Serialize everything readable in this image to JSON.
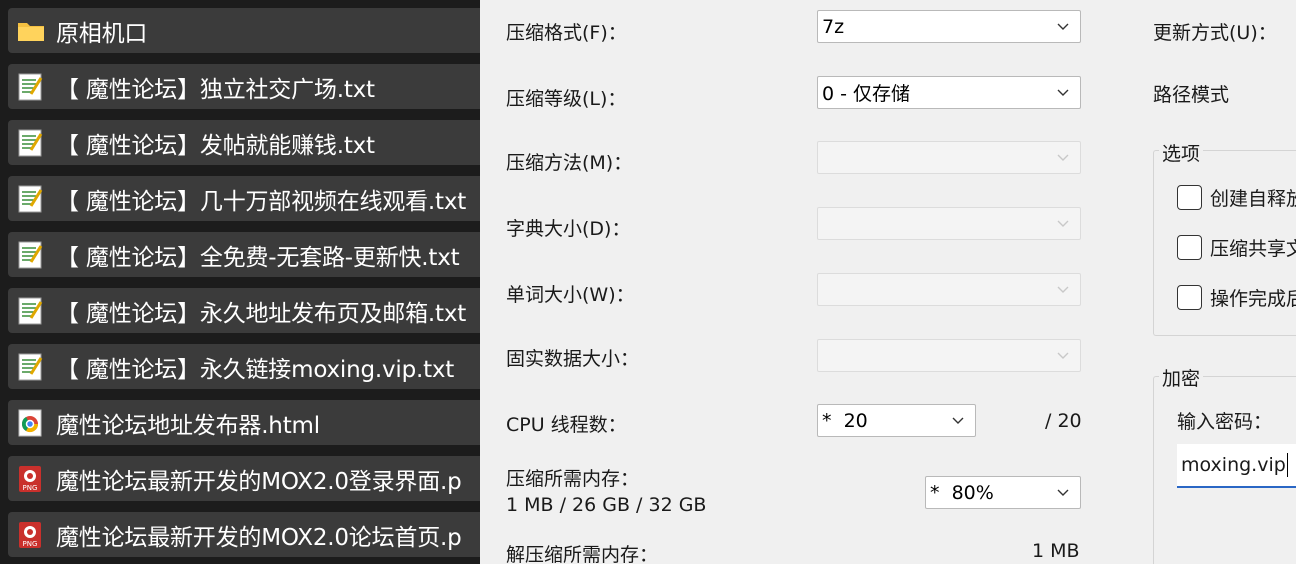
{
  "files": [
    {
      "name": "原相机口",
      "icon": "folder-icon"
    },
    {
      "name": "【 魔性论坛】独立社交广场.txt",
      "icon": "text-file-icon"
    },
    {
      "name": "【 魔性论坛】发帖就能赚钱.txt",
      "icon": "text-file-icon"
    },
    {
      "name": "【 魔性论坛】几十万部视频在线观看.txt",
      "icon": "text-file-icon"
    },
    {
      "name": "【 魔性论坛】全免费-无套路-更新快.txt",
      "icon": "text-file-icon"
    },
    {
      "name": "【 魔性论坛】永久地址发布页及邮箱.txt",
      "icon": "text-file-icon"
    },
    {
      "name": "【 魔性论坛】永久链接moxing.vip.txt",
      "icon": "text-file-icon"
    },
    {
      "name": "魔性论坛地址发布器.html",
      "icon": "chrome-html-icon"
    },
    {
      "name": "魔性论坛最新开发的MOX2.0登录界面.p",
      "icon": "png-file-icon"
    },
    {
      "name": "魔性论坛最新开发的MOX2.0论坛首页.p",
      "icon": "png-file-icon"
    }
  ],
  "dialog": {
    "format_label": "压缩格式(F)：",
    "format_value": "7z",
    "level_label": "压缩等级(L)：",
    "level_value": "0 - 仅存储",
    "method_label": "压缩方法(M)：",
    "dict_label": "字典大小(D)：",
    "word_label": "单词大小(W)：",
    "solid_label": "固实数据大小：",
    "cpu_label": "CPU 线程数：",
    "cpu_value": "*  20",
    "cpu_total": "/ 20",
    "mem_label": "压缩所需内存：",
    "mem_value": "1 MB / 26 GB / 32 GB",
    "mem_percent": "*  80%",
    "decomp_label": "解压缩所需内存：",
    "decomp_value": "1 MB",
    "update_label": "更新方式(U)：",
    "path_label": "路径模式",
    "options_title": "选项",
    "options": [
      "创建自释放",
      "压缩共享文",
      "操作完成后"
    ],
    "encrypt_title": "加密",
    "password_label": "输入密码：",
    "password_value": "moxing.vip"
  },
  "colors": {
    "list_bg": "#1c1c1c",
    "row_bg": "#3b3b3b",
    "dialog_bg": "#f0f0f0",
    "focus_accent": "#2a67c5"
  }
}
